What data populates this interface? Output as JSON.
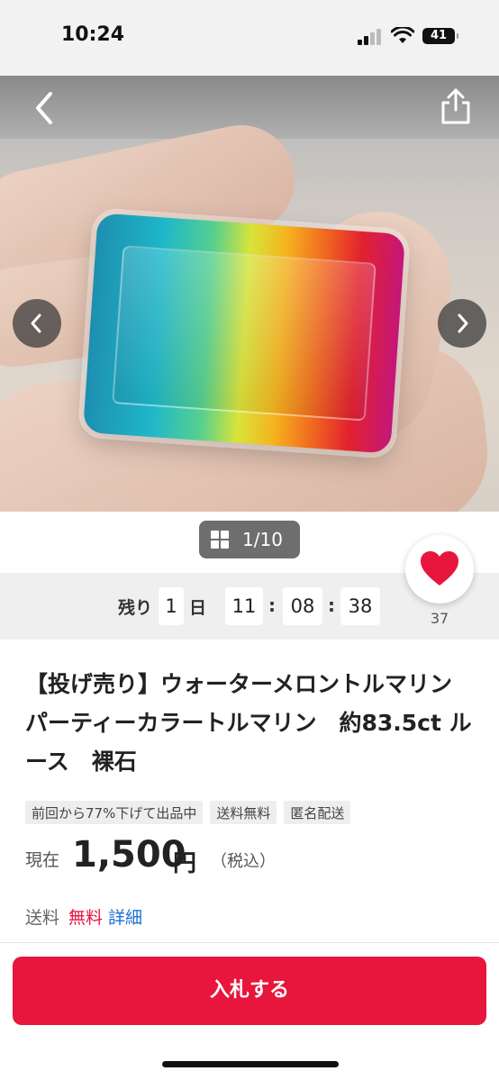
{
  "status_bar": {
    "time": "10:24",
    "battery": "41"
  },
  "gallery": {
    "page_indicator": "1/10"
  },
  "countdown": {
    "remaining_label": "残り",
    "days": "1",
    "day_unit": "日",
    "hours": "11",
    "minutes": "08",
    "seconds": "38",
    "separator": ":"
  },
  "favorite": {
    "count": "37"
  },
  "item": {
    "title": "【投げ売り】ウォーターメロントルマリン　パーティーカラートルマリン　約83.5ct ルース　裸石",
    "tags": [
      "前回から77%下げて出品中",
      "送料無料",
      "匿名配送"
    ],
    "price_label": "現在",
    "price": "1,500",
    "currency": "円",
    "tax_note": "（税込）",
    "shipping_label": "送料",
    "shipping_value": "無料",
    "shipping_detail": "詳細"
  },
  "actions": {
    "bid_label": "入札する"
  },
  "colors": {
    "accent": "#e8163d",
    "link": "#1a6fd0"
  }
}
